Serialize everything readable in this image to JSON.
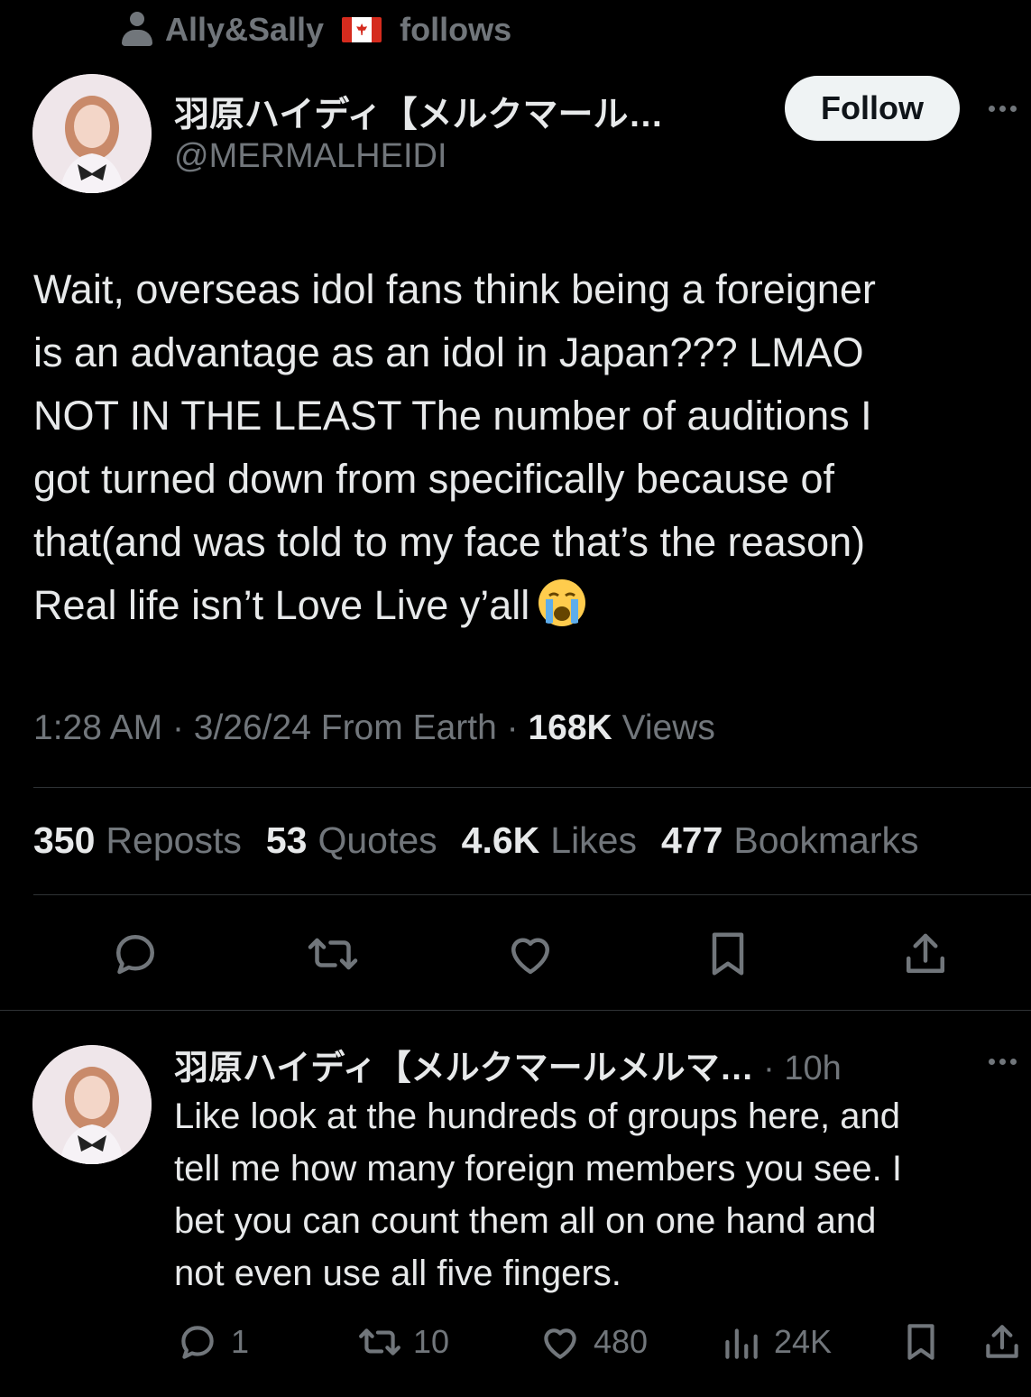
{
  "social_context": {
    "name": "Ally&Sally",
    "action": "follows"
  },
  "tweet": {
    "display_name": "羽原ハイディ【メルクマール…",
    "handle": "@MERMALHEIDI",
    "follow_label": "Follow",
    "text_lines": [
      "Wait, overseas idol fans think being a foreigner",
      "is an advantage as an idol in Japan??? LMAO",
      "NOT IN THE LEAST The number of auditions I",
      "got turned down from specifically because of",
      "that(and was told to my face that’s the reason)",
      "Real life isn’t Love Live y’all"
    ],
    "time": "1:28 AM",
    "date": "3/26/24",
    "source": "From Earth",
    "separator": "·",
    "views_count": "168K",
    "views_label": "Views",
    "stats": [
      {
        "count": "350",
        "label": "Reposts"
      },
      {
        "count": "53",
        "label": "Quotes"
      },
      {
        "count": "4.6K",
        "label": "Likes"
      },
      {
        "count": "477",
        "label": "Bookmarks"
      }
    ]
  },
  "reply": {
    "display_name": "羽原ハイディ【メルクマールメルマ…",
    "separator": "·",
    "time": "10h",
    "text_lines": [
      "Like look at the hundreds of groups here, and",
      "tell me how many foreign members you see. I",
      "bet you can count them all on one hand and",
      "not even use all five fingers."
    ],
    "replies": "1",
    "reposts": "10",
    "likes": "480",
    "views": "24K"
  },
  "colors": {
    "background": "#000000",
    "text": "#e7e9ea",
    "muted": "#71767b",
    "divider": "#2f3336",
    "follow_button": "#eff3f4"
  }
}
